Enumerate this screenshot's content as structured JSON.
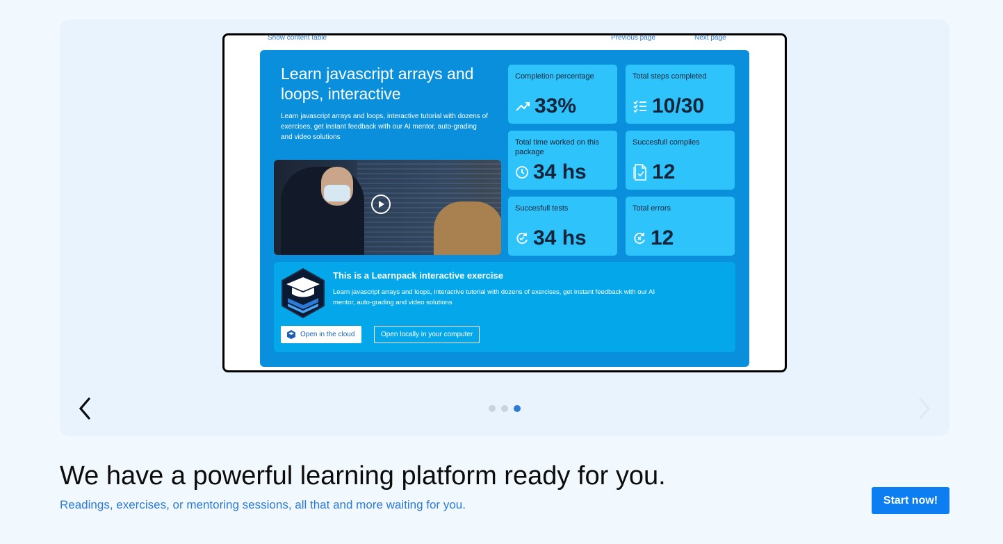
{
  "carousel": {
    "slide": {
      "topnav": {
        "content_table": "Show content table",
        "previous": "Previous page",
        "next": "Next page"
      },
      "panel": {
        "title": "Learn javascript arrays and loops, interactive",
        "description": "Learn javascript arrays and loops, interactive tutorial with dozens of exercises, get instant feedback with our AI mentor, auto-grading and video solutions",
        "stats": [
          {
            "label": "Completion percentage",
            "value": "33%",
            "icon": "trending-up-icon"
          },
          {
            "label": "Total steps completed",
            "value": "10/30",
            "icon": "checklist-icon"
          },
          {
            "label": "Total time worked on this package",
            "value": "34 hs",
            "icon": "clock-icon"
          },
          {
            "label": "Succesfull compiles",
            "value": "12",
            "icon": "document-check-icon"
          },
          {
            "label": "Succesfull tests",
            "value": "34 hs",
            "icon": "refresh-check-icon"
          },
          {
            "label": "Total errors",
            "value": "12",
            "icon": "refresh-error-icon"
          }
        ],
        "exercise": {
          "title": "This is a Learnpack interactive exercise",
          "description": "Learn javascript arrays and loops, interactive tutorial with dozens of exercises, get instant feedback with our AI mentor, auto-grading and video solutions",
          "open_cloud": "Open in the cloud",
          "open_local": "Open locally in your computer"
        }
      }
    },
    "dots": 3,
    "active_dot": 2
  },
  "hero": {
    "title": "We have a powerful learning platform ready for you.",
    "subtitle": "Readings, exercises, or mentoring sessions, all that and more waiting for you.",
    "cta": "Start now!"
  },
  "colors": {
    "accent": "#0d7ef2",
    "panel": "#0a8fdc",
    "stat_card": "#2ec3fa",
    "exercise": "#04a8ea"
  }
}
